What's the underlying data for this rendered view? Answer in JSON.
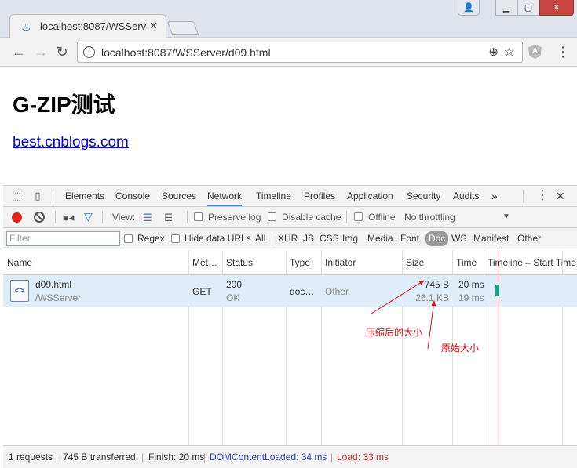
{
  "browser": {
    "tab_title": "localhost:8087/WSServ",
    "address": "localhost:8087/WSServer/d09.html"
  },
  "page": {
    "heading": "G-ZIP测试",
    "link": "best.cnblogs.com"
  },
  "devtools": {
    "tabs": [
      "Elements",
      "Console",
      "Sources",
      "Network",
      "Timeline",
      "Profiles",
      "Application",
      "Security",
      "Audits"
    ],
    "active_tab": "Network",
    "toolbar": {
      "view_label": "View:",
      "preserve_log": "Preserve log",
      "disable_cache": "Disable cache",
      "offline": "Offline",
      "throttling": "No throttling"
    },
    "filter": {
      "placeholder": "Filter",
      "regex": "Regex",
      "hide_data_urls": "Hide data URLs",
      "types": [
        "All",
        "XHR",
        "JS",
        "CSS",
        "Img",
        "Media",
        "Font",
        "Doc",
        "WS",
        "Manifest",
        "Other"
      ],
      "selected_type": "Doc"
    },
    "columns": [
      "Name",
      "Met…",
      "Status",
      "Type",
      "Initiator",
      "Size",
      "Time",
      "Timeline – Start Time"
    ],
    "rows": [
      {
        "name": "d09.html",
        "path": "/WSServer",
        "method": "GET",
        "status_code": "200",
        "status_text": "OK",
        "type": "doc…",
        "initiator": "Other",
        "size_transferred": "745 B",
        "size_content": "26.1 KB",
        "time": "20 ms",
        "latency": "19 ms"
      }
    ],
    "status_bar": {
      "requests": "1 requests",
      "transferred": "745 B transferred",
      "finish": "Finish: 20 ms",
      "dom_loaded": "DOMContentLoaded: 34 ms",
      "load": "Load: 33 ms"
    }
  },
  "annotations": {
    "compressed": "压缩后的大小",
    "original": "原始大小"
  },
  "colors": {
    "dom_loaded": "#2c45d6",
    "load": "#d32c2c",
    "annotation": "#d21010"
  }
}
